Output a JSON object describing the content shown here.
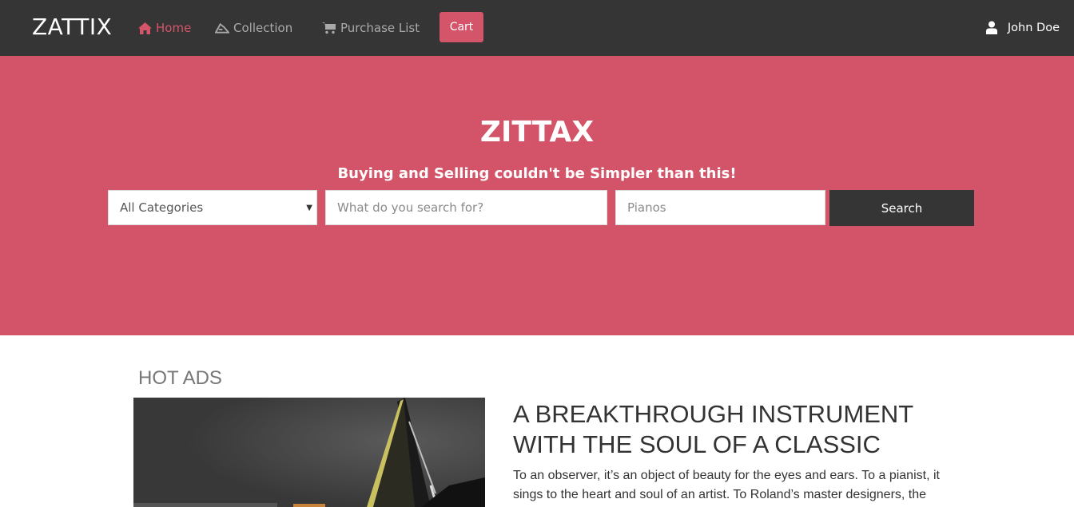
{
  "nav": {
    "brand": "ZATTIX",
    "home": "Home",
    "collection": "Collection",
    "purchase_list": "Purchase List",
    "cart": "Cart",
    "user": "John Doe"
  },
  "hero": {
    "title": "ZITTAX",
    "subtitle": "Buying and Selling couldn't be Simpler than this!",
    "category_selected": "All Categories",
    "search_placeholder": "What do you search for?",
    "location_placeholder": "Pianos",
    "search_button": "Search"
  },
  "content": {
    "section_title": "HOT ADS",
    "ad_headline": "A BREAKTHROUGH INSTRUMENT WITH THE SOUL OF A CLASSIC",
    "ad_body": "To an observer, it’s an object of beauty for the eyes and ears. To a pianist, it sings to the heart and soul of an artist. To Roland’s master designers, the"
  },
  "colors": {
    "navbar": "#353535",
    "accent": "#d35468",
    "nav_inactive": "#a9a9a9"
  },
  "icons": [
    "home-icon",
    "collection-icon",
    "cart-icon",
    "user-icon"
  ]
}
